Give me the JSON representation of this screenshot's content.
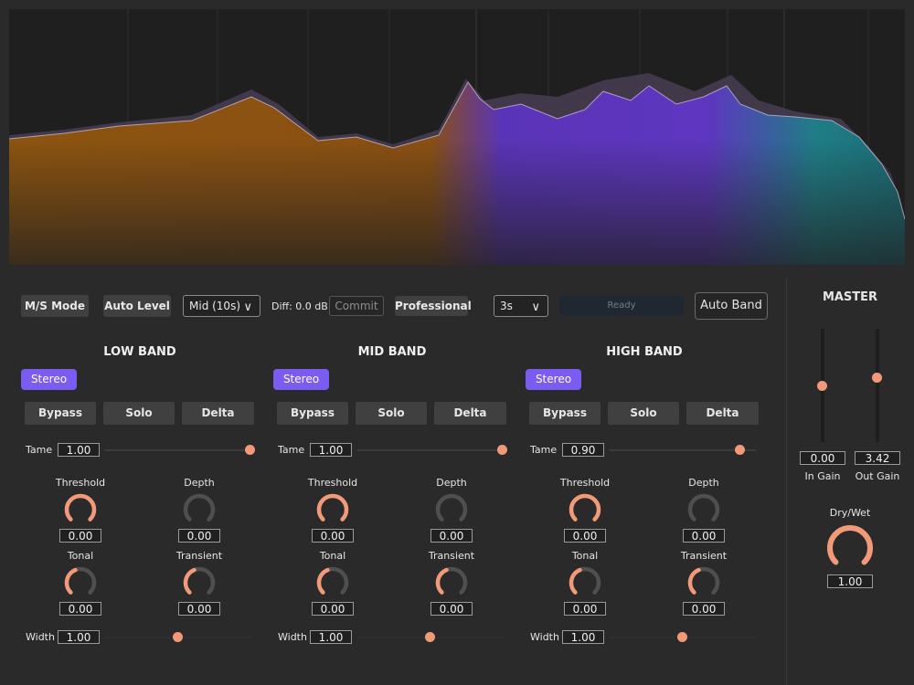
{
  "toolbar": {
    "ms_mode": "M/S Mode",
    "auto_level": "Auto Level",
    "mid_select": "Mid (10s)",
    "diff": "Diff: 0.0 dB",
    "commit": "Commit",
    "professional": "Professional",
    "time_select": "3s",
    "status": "Ready",
    "auto_band": "Auto Band"
  },
  "bands": [
    {
      "title": "LOW BAND",
      "mode": "Stereo",
      "bypass": "Bypass",
      "solo": "Solo",
      "delta": "Delta",
      "tame_label": "Tame",
      "tame": "1.00",
      "tame_level": 1.0,
      "threshold_label": "Threshold",
      "threshold": "0.00",
      "depth_label": "Depth",
      "depth": "0.00",
      "tonal_label": "Tonal",
      "tonal": "0.00",
      "transient_label": "Transient",
      "transient": "0.00",
      "width_label": "Width",
      "width": "1.00",
      "width_level": 0.5
    },
    {
      "title": "MID BAND",
      "mode": "Stereo",
      "bypass": "Bypass",
      "solo": "Solo",
      "delta": "Delta",
      "tame_label": "Tame",
      "tame": "1.00",
      "tame_level": 1.0,
      "threshold_label": "Threshold",
      "threshold": "0.00",
      "depth_label": "Depth",
      "depth": "0.00",
      "tonal_label": "Tonal",
      "tonal": "0.00",
      "transient_label": "Transient",
      "transient": "0.00",
      "width_label": "Width",
      "width": "1.00",
      "width_level": 0.5
    },
    {
      "title": "HIGH BAND",
      "mode": "Stereo",
      "bypass": "Bypass",
      "solo": "Solo",
      "delta": "Delta",
      "tame_label": "Tame",
      "tame": "0.90",
      "tame_level": 0.9,
      "threshold_label": "Threshold",
      "threshold": "0.00",
      "depth_label": "Depth",
      "depth": "0.00",
      "tonal_label": "Tonal",
      "tonal": "0.00",
      "transient_label": "Transient",
      "transient": "0.00",
      "width_label": "Width",
      "width": "1.00",
      "width_level": 0.5
    }
  ],
  "master": {
    "title": "MASTER",
    "in_gain_label": "In Gain",
    "in_gain": "0.00",
    "in_gain_level": 0.5,
    "out_gain_label": "Out Gain",
    "out_gain": "3.42",
    "out_gain_level": 0.57,
    "drywet_label": "Dry/Wet",
    "drywet": "1.00",
    "drywet_level": 1.0
  },
  "colors": {
    "accent": "#7b5cf0",
    "knob": "#f29a78",
    "low": "#8a4f12",
    "mid": "#5b35b0",
    "high": "#1a7a80"
  }
}
